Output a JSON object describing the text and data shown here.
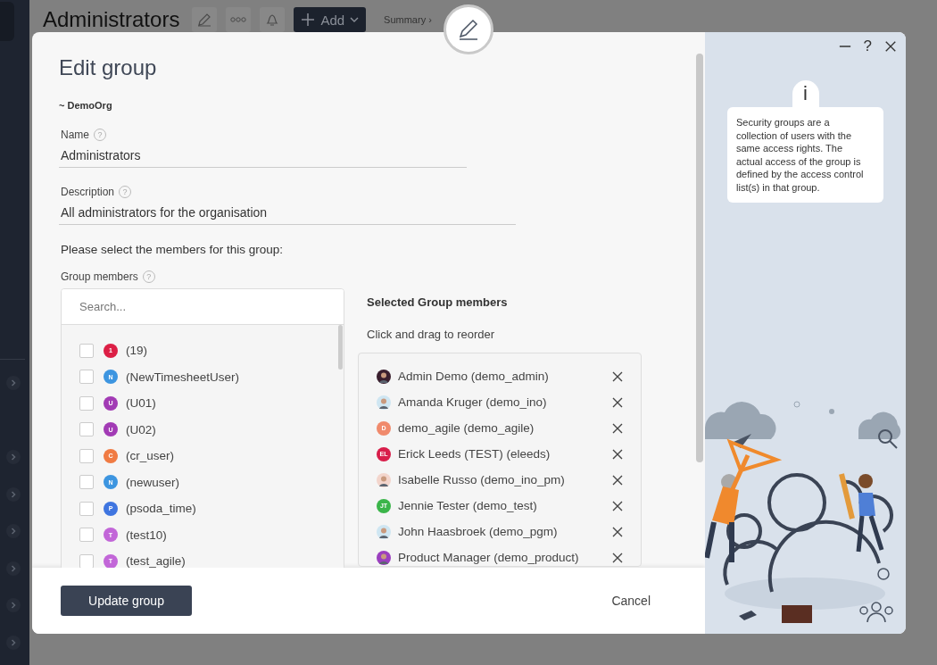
{
  "page": {
    "title": "Administrators",
    "add_button": "Add",
    "breadcrumb": "Summary ›"
  },
  "dialog": {
    "title": "Edit group",
    "organisation": "~ DemoOrg",
    "fields": [
      {
        "label": "Name",
        "hint_icon": "?",
        "value": "Administrators"
      },
      {
        "label": "Description",
        "hint_icon": "?",
        "value": "All administrators for the organisation"
      }
    ],
    "members_hint_icon": "?",
    "members_prompt": "Please select the members for this group:",
    "members_label": "Group members",
    "search": {
      "placeholder": "Search..."
    },
    "available": [
      {
        "name": "(19)",
        "initials": "1",
        "color": "#dc1f45",
        "checked": false
      },
      {
        "name": "(NewTimesheetUser)",
        "initials": "N",
        "color": "#3d95e0",
        "checked": false
      },
      {
        "name": "(U01)",
        "initials": "U",
        "color": "#a23bb5",
        "checked": false
      },
      {
        "name": "(U02)",
        "initials": "U",
        "color": "#a23bb5",
        "checked": false
      },
      {
        "name": "(cr_user)",
        "initials": "C",
        "color": "#f07b43",
        "checked": false
      },
      {
        "name": "(newuser)",
        "initials": "N",
        "color": "#3d95e0",
        "checked": false
      },
      {
        "name": "(psoda_time)",
        "initials": "P",
        "color": "#3f75e0",
        "checked": false
      },
      {
        "name": "(test10)",
        "initials": "T",
        "color": "#c266d8",
        "checked": false
      },
      {
        "name": "(test_agile)",
        "initials": "T",
        "color": "#c266d8",
        "checked": false
      }
    ],
    "selected_title": "Selected Group members",
    "selected_hint": "Click and drag to reorder",
    "selected": [
      {
        "name": "Admin Demo (demo_admin)",
        "kind": "photo",
        "color": "#3a1f2e"
      },
      {
        "name": "Amanda Kruger (demo_ino)",
        "kind": "photo",
        "color": "#cfe6f2"
      },
      {
        "name": "demo_agile (demo_agile)",
        "kind": "initials",
        "initials": "D",
        "color": "#f08a6c"
      },
      {
        "name": "Erick Leeds (TEST) (eleeds)",
        "kind": "initials",
        "initials": "EL",
        "color": "#d81e4a"
      },
      {
        "name": "Isabelle Russo (demo_ino_pm)",
        "kind": "photo",
        "color": "#f3d5cc"
      },
      {
        "name": "Jennie Tester (demo_test)",
        "kind": "initials",
        "initials": "JT",
        "color": "#3bb54a"
      },
      {
        "name": "John Haasbroek (demo_pgm)",
        "kind": "photo",
        "color": "#cfe6f2"
      },
      {
        "name": "Product Manager (demo_product)",
        "kind": "photo",
        "color": "#9b3fbf"
      }
    ],
    "submit": "Update group",
    "cancel": "Cancel"
  },
  "help": {
    "icon_letter": "i",
    "help_button": "?",
    "text": "Security groups are a collection of users with the same access rights. The actual access of the group is defined by the access control list(s) in that group."
  }
}
